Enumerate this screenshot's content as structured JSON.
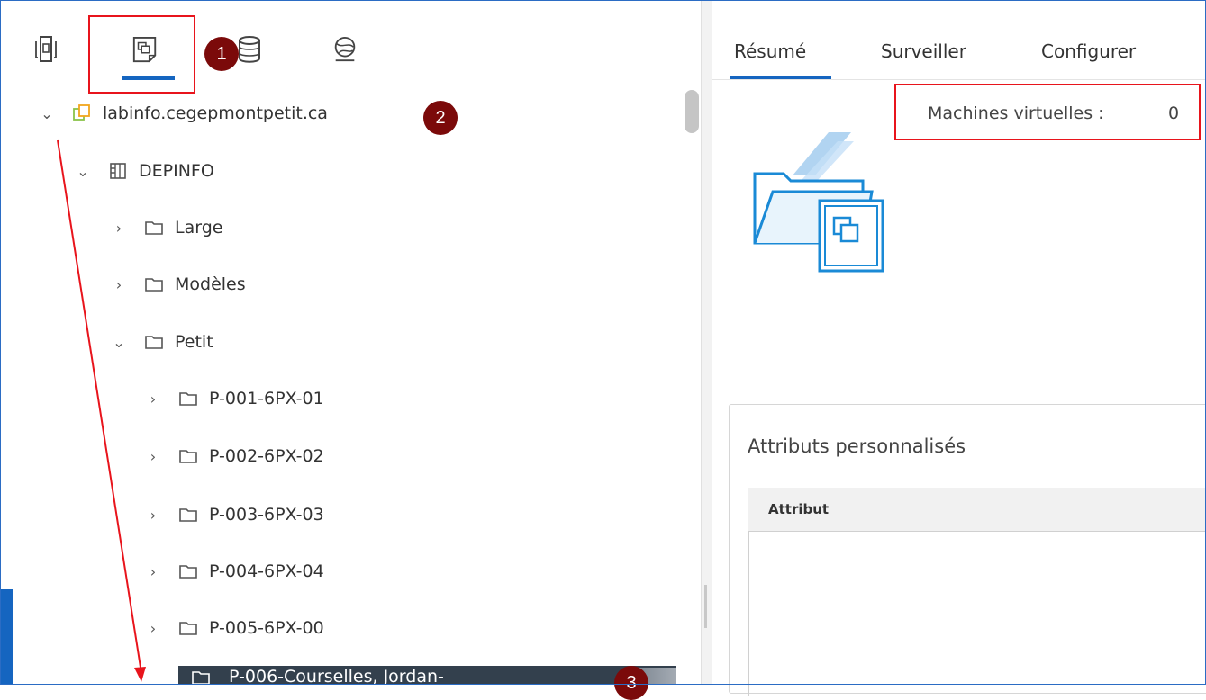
{
  "left_tabs": [
    {
      "name": "hosts-clusters",
      "icon": "hosts-clusters-icon"
    },
    {
      "name": "vms-templates",
      "icon": "vms-templates-icon",
      "selected": true
    },
    {
      "name": "storage",
      "icon": "storage-icon"
    },
    {
      "name": "networking",
      "icon": "networking-icon"
    }
  ],
  "badges": {
    "b1": "1",
    "b2": "2",
    "b3": "3"
  },
  "tree": {
    "vcenter": "labinfo.cegepmontpetit.ca",
    "datacenter": "DEPINFO",
    "folders": [
      "Large",
      "Modèles",
      "Petit"
    ],
    "subfolders": [
      "P-001-6PX-01",
      "P-002-6PX-02",
      "P-003-6PX-03",
      "P-004-6PX-04",
      "P-005-6PX-00"
    ],
    "selected": "P-006-Courselles, Jordan-"
  },
  "right_tabs": [
    "Résumé",
    "Surveiller",
    "Configurer"
  ],
  "summary": {
    "vm_label": "Machines virtuelles :",
    "vm_count": "0"
  },
  "attributes": {
    "title": "Attributs personnalisés",
    "column": "Attribut"
  },
  "colors": {
    "accent": "#1565c0",
    "annotation_red": "#e8141c",
    "badge": "#7b0a0a",
    "selected_row": "#33404d"
  }
}
